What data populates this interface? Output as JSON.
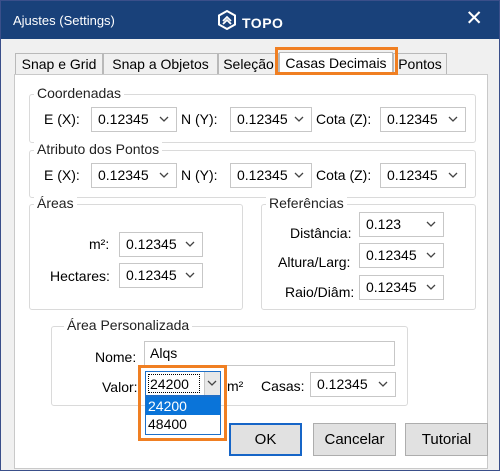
{
  "window": {
    "title": "Ajustes  (Settings)",
    "brand": "TOPO",
    "close_glyph": "✕"
  },
  "tabs": [
    {
      "label": "Snap e Grid",
      "active": false
    },
    {
      "label": "Snap a Objetos",
      "active": false
    },
    {
      "label": "Seleção",
      "active": false
    },
    {
      "label": "Casas Decimais",
      "active": true
    },
    {
      "label": "Pontos",
      "active": false
    }
  ],
  "coordenadas": {
    "legend": "Coordenadas",
    "e_label": "E (X):",
    "e_value": "0.12345",
    "n_label": "N (Y):",
    "n_value": "0.12345",
    "cota_label": "Cota (Z):",
    "cota_value": "0.12345"
  },
  "atributo": {
    "legend": "Atributo dos Pontos",
    "e_label": "E (X):",
    "e_value": "0.12345",
    "n_label": "N (Y):",
    "n_value": "0.12345",
    "cota_label": "Cota (Z):",
    "cota_value": "0.12345"
  },
  "areas": {
    "legend": "Áreas",
    "m2_label": "m²:",
    "m2_value": "0.12345",
    "hectares_label": "Hectares:",
    "hectares_value": "0.12345"
  },
  "referencias": {
    "legend": "Referências",
    "distancia_label": "Distância:",
    "distancia_value": "0.123",
    "altura_label": "Altura/Larg:",
    "altura_value": "0.12345",
    "raio_label": "Raio/Diâm:",
    "raio_value": "0.12345"
  },
  "area_personalizada": {
    "legend": "Área Personalizada",
    "nome_label": "Nome:",
    "nome_value": "Alqs",
    "valor_label": "Valor:",
    "valor_value": "24200",
    "unit_label": "m²",
    "casas_label": "Casas:",
    "casas_value": "0.12345",
    "dropdown_options": [
      "24200",
      "48400"
    ]
  },
  "buttons": {
    "ok": "OK",
    "cancelar": "Cancelar",
    "tutorial": "Tutorial"
  },
  "colors": {
    "titlebar": "#19417a",
    "highlight": "#f07f22",
    "selection": "#0a74d9"
  }
}
